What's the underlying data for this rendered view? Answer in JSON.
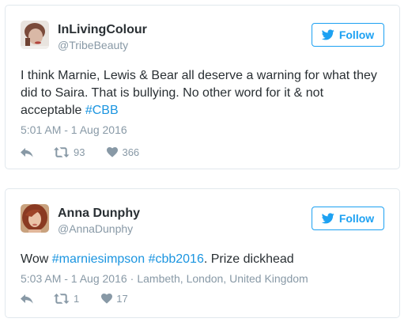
{
  "colors": {
    "accent": "#1da1f2",
    "link": "#1b95e0",
    "text": "#292f33",
    "muted": "#8899a6",
    "border": "#e1e8ed"
  },
  "follow_icon": "twitter-bird-icon",
  "tweets": [
    {
      "display_name": "InLivingColour",
      "handle": "@TribeBeauty",
      "follow_label": "Follow",
      "text_before": "I think Marnie, Lewis & Bear all deserve a warning for what they did to Saira. That is bullying. No other word for it & not acceptable ",
      "hashtag": "#CBB",
      "timestamp": "5:01 AM - 1 Aug 2016",
      "retweets": "93",
      "likes": "366"
    },
    {
      "display_name": "Anna Dunphy",
      "handle": "@AnnaDunphy",
      "follow_label": "Follow",
      "text_prefix": "Wow ",
      "hashtag_1": "#marniesimpson",
      "hashtag_2": "#cbb2016",
      "text_suffix": ". Prize dickhead",
      "timestamp": "5:03 AM - 1 Aug 2016",
      "separator": "·",
      "location": "Lambeth, London, United Kingdom",
      "retweets": "1",
      "likes": "17"
    }
  ]
}
